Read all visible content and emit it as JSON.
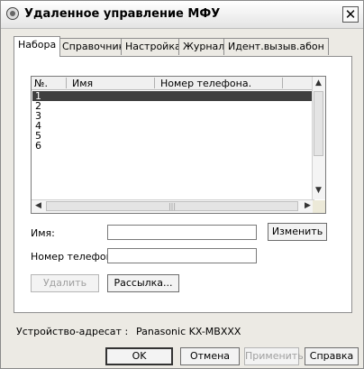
{
  "window": {
    "title": "Удаленное управление МФУ",
    "close_glyph": "✕",
    "app_icon": "disc-icon"
  },
  "tabs": [
    {
      "label": "Набора"
    },
    {
      "label": "Справочник"
    },
    {
      "label": "Настройка"
    },
    {
      "label": "Журнал"
    },
    {
      "label": "Идент.вызыв.абон"
    }
  ],
  "list": {
    "columns": [
      "№.",
      "Имя",
      "Номер телефона."
    ],
    "rows": [
      {
        "num": "1",
        "name": "",
        "phone": ""
      },
      {
        "num": "2",
        "name": "",
        "phone": ""
      },
      {
        "num": "3",
        "name": "",
        "phone": ""
      },
      {
        "num": "4",
        "name": "",
        "phone": ""
      },
      {
        "num": "5",
        "name": "",
        "phone": ""
      },
      {
        "num": "6",
        "name": "",
        "phone": ""
      }
    ],
    "selected_row": "1"
  },
  "form": {
    "name_label": "Имя:",
    "name_value": "",
    "phone_label": "Номер телефона.:",
    "phone_value": "",
    "edit_button": "Изменить",
    "delete_button": "Удалить",
    "broadcast_button": "Рассылка..."
  },
  "footer": {
    "device_label": "Устройство-адресат :",
    "device_value": "Panasonic KX-MBXXX",
    "ok": "OK",
    "cancel": "Отмена",
    "apply": "Применить",
    "help": "Справка"
  }
}
